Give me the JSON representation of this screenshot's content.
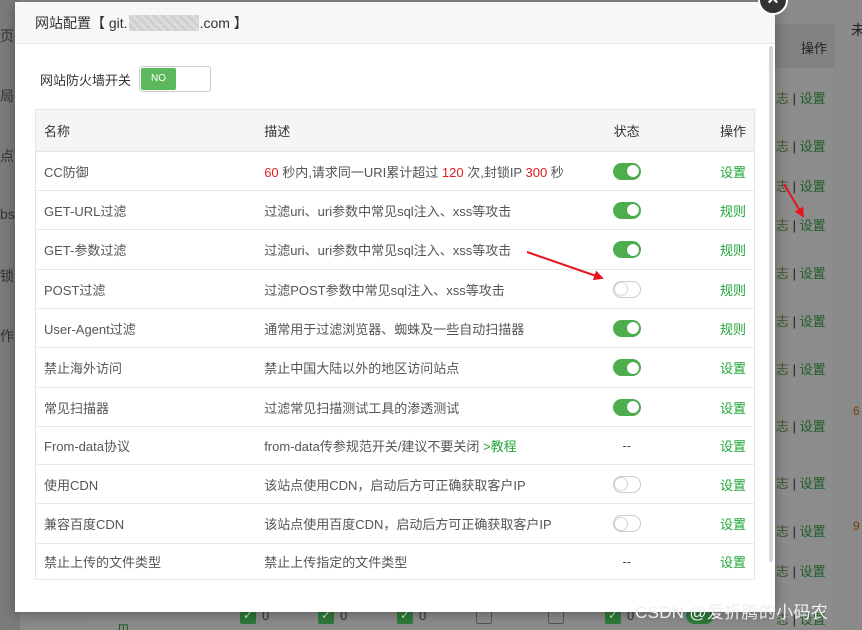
{
  "background": {
    "sidebar_items": [
      "页",
      "局配",
      "点配",
      "bs",
      "锁盾",
      "作日"
    ],
    "table_header": "操作",
    "far_right_header": "未",
    "op_rows": [
      {
        "log": "志",
        "sep": "|",
        "action": "设置"
      },
      {
        "log": "志",
        "sep": "|",
        "action": "设置"
      },
      {
        "log": "志",
        "sep": "|",
        "action": "设置"
      },
      {
        "log": "志",
        "sep": "|",
        "action": "设置"
      },
      {
        "log": "志",
        "sep": "|",
        "action": "设置"
      },
      {
        "log": "志",
        "sep": "|",
        "action": "设置"
      },
      {
        "log": "志",
        "sep": "|",
        "action": "设置"
      },
      {
        "log": "志",
        "sep": "|",
        "action": "设置"
      },
      {
        "log": "志",
        "sep": "|",
        "action": "设置"
      },
      {
        "log": "志",
        "sep": "|",
        "action": "设置"
      },
      {
        "log": "志",
        "sep": "|",
        "action": "设置"
      },
      {
        "log": "志",
        "sep": "|",
        "action": "设置"
      }
    ],
    "edge_nums": [
      "6",
      "9"
    ],
    "bottom_counts": [
      "0",
      "0",
      "0",
      "0"
    ],
    "bottom_link": "m"
  },
  "watermark": "CSDN @爱折腾的小码农",
  "modal": {
    "title_prefix": "网站配置【 git.",
    "title_suffix": ".com 】",
    "close_glyph": "×",
    "firewall_label": "网站防火墙开关",
    "firewall_switch_text": "NO",
    "columns": [
      "名称",
      "描述",
      "状态",
      "操作"
    ],
    "cc_desc": {
      "p1": "60",
      "p2": " 秒内,请求同一URI累计超过 ",
      "p3": "120",
      "p4": " 次,封锁IP ",
      "p5": "300",
      "p6": " 秒"
    },
    "rows": [
      {
        "name": "CC防御",
        "desc": "",
        "status": "on",
        "action": "设置"
      },
      {
        "name": "GET-URL过滤",
        "desc": "过滤uri、uri参数中常见sql注入、xss等攻击",
        "status": "on",
        "action": "规则"
      },
      {
        "name": "GET-参数过滤",
        "desc": "过滤uri、uri参数中常见sql注入、xss等攻击",
        "status": "on",
        "action": "规则"
      },
      {
        "name": "POST过滤",
        "desc": "过滤POST参数中常见sql注入、xss等攻击",
        "status": "off",
        "action": "规则"
      },
      {
        "name": "User-Agent过滤",
        "desc": "通常用于过滤浏览器、蜘蛛及一些自动扫描器",
        "status": "on",
        "action": "规则"
      },
      {
        "name": "禁止海外访问",
        "desc": "禁止中国大陆以外的地区访问站点",
        "status": "on",
        "action": "设置"
      },
      {
        "name": "常见扫描器",
        "desc": "过滤常见扫描测试工具的渗透测试",
        "status": "on",
        "action": "设置"
      },
      {
        "name": "From-data协议",
        "desc": "from-data传参规范开关/建议不要关闭",
        "desc_link": ">教程",
        "status": "--",
        "action": "设置"
      },
      {
        "name": "使用CDN",
        "desc": "该站点使用CDN，启动后方可正确获取客户IP",
        "status": "off",
        "action": "设置"
      },
      {
        "name": "兼容百度CDN",
        "desc": "该站点使用百度CDN，启动后方可正确获取客户IP",
        "status": "off",
        "action": "设置"
      },
      {
        "name": "禁止上传的文件类型",
        "desc": "禁止上传指定的文件类型",
        "status": "--",
        "action": "设置"
      }
    ]
  },
  "colors": {
    "accent_green": "#20a53a",
    "switch_on": "#4cae4c",
    "highlight_red": "#e02020",
    "annotation_arrow": "#e8141c"
  }
}
